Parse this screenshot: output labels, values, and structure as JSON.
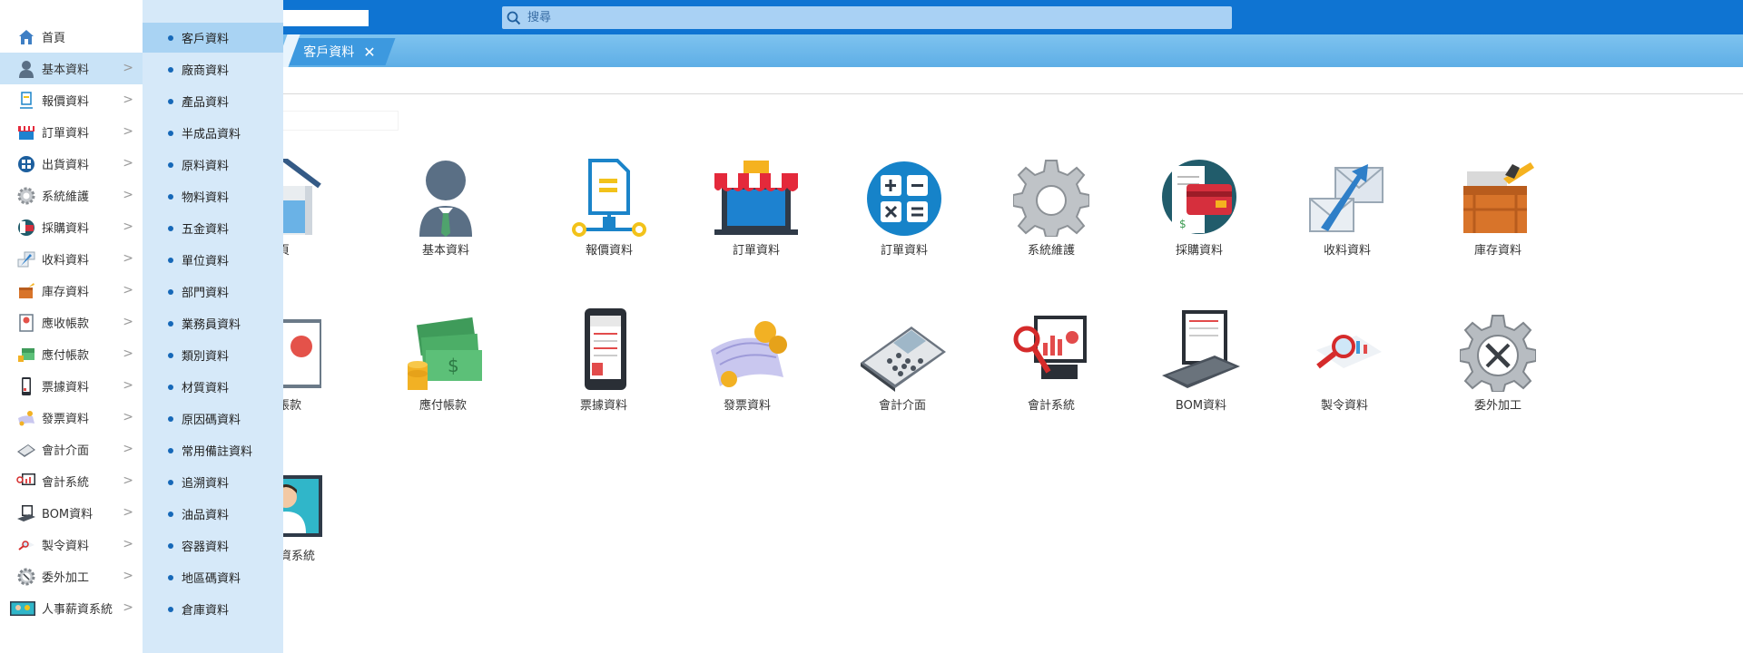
{
  "search": {
    "placeholder": "搜尋"
  },
  "tabs": [
    {
      "label": "客戶資料",
      "close": "✕"
    }
  ],
  "menu": {
    "items": [
      {
        "label": "首頁",
        "icon": "home-icon"
      },
      {
        "label": "基本資料",
        "icon": "user-icon"
      },
      {
        "label": "報價資料",
        "icon": "quote-icon"
      },
      {
        "label": "訂單資料",
        "icon": "store-icon"
      },
      {
        "label": "出貨資料",
        "icon": "shipping-icon"
      },
      {
        "label": "系統維護",
        "icon": "gear-icon"
      },
      {
        "label": "採購資料",
        "icon": "purchase-icon"
      },
      {
        "label": "收料資料",
        "icon": "receive-icon"
      },
      {
        "label": "庫存資料",
        "icon": "box-icon"
      },
      {
        "label": "應收帳款",
        "icon": "receivable-icon"
      },
      {
        "label": "應付帳款",
        "icon": "cash-icon"
      },
      {
        "label": "票據資料",
        "icon": "phone-icon"
      },
      {
        "label": "發票資料",
        "icon": "invoice-icon"
      },
      {
        "label": "會計介面",
        "icon": "calculator-icon"
      },
      {
        "label": "會計系統",
        "icon": "report-icon"
      },
      {
        "label": "BOM資料",
        "icon": "laptop-icon"
      },
      {
        "label": "製令資料",
        "icon": "magnifier-icon"
      },
      {
        "label": "委外加工",
        "icon": "tools-icon"
      },
      {
        "label": "人事薪資系統",
        "icon": "person-icon"
      }
    ]
  },
  "submenu": {
    "items": [
      "客戶資料",
      "廠商資料",
      "產品資料",
      "半成品資料",
      "原料資料",
      "物料資料",
      "五金資料",
      "單位資料",
      "部門資料",
      "業務員資料",
      "類別資料",
      "材質資料",
      "原因碼資料",
      "常用備註資料",
      "追溯資料",
      "油品資料",
      "容器資料",
      "地區碼資料",
      "倉庫資料"
    ]
  },
  "grid": {
    "row1": [
      {
        "label": "頁",
        "icon": "home-icon"
      },
      {
        "label": "基本資料",
        "icon": "user-icon"
      },
      {
        "label": "報價資料",
        "icon": "quote-icon"
      },
      {
        "label": "訂單資料",
        "icon": "store-icon"
      },
      {
        "label": "訂單資料",
        "icon": "calculator-round-icon"
      },
      {
        "label": "系統維護",
        "icon": "gear-icon"
      },
      {
        "label": "採購資料",
        "icon": "credit-card-icon"
      },
      {
        "label": "收料資料",
        "icon": "mail-icon"
      },
      {
        "label": "庫存資料",
        "icon": "crate-icon"
      }
    ],
    "row2": [
      {
        "label": "帳款",
        "icon": "receivable-icon"
      },
      {
        "label": "應付帳款",
        "icon": "cash-icon"
      },
      {
        "label": "票據資料",
        "icon": "phone-icon"
      },
      {
        "label": "發票資料",
        "icon": "invoice-icon"
      },
      {
        "label": "會計介面",
        "icon": "calculator-icon"
      },
      {
        "label": "會計系統",
        "icon": "report-icon"
      },
      {
        "label": "BOM資料",
        "icon": "laptop-icon"
      },
      {
        "label": "製令資料",
        "icon": "magnifier-icon"
      },
      {
        "label": "委外加工",
        "icon": "tools-icon"
      }
    ],
    "row3": [
      {
        "label": "資系統",
        "icon": "person-icon"
      }
    ]
  },
  "colors": {
    "topbar": "#0f74d2",
    "tabbar": "#6bb7ea",
    "submenu": "#d6e9f9",
    "accent": "#1668b8"
  }
}
